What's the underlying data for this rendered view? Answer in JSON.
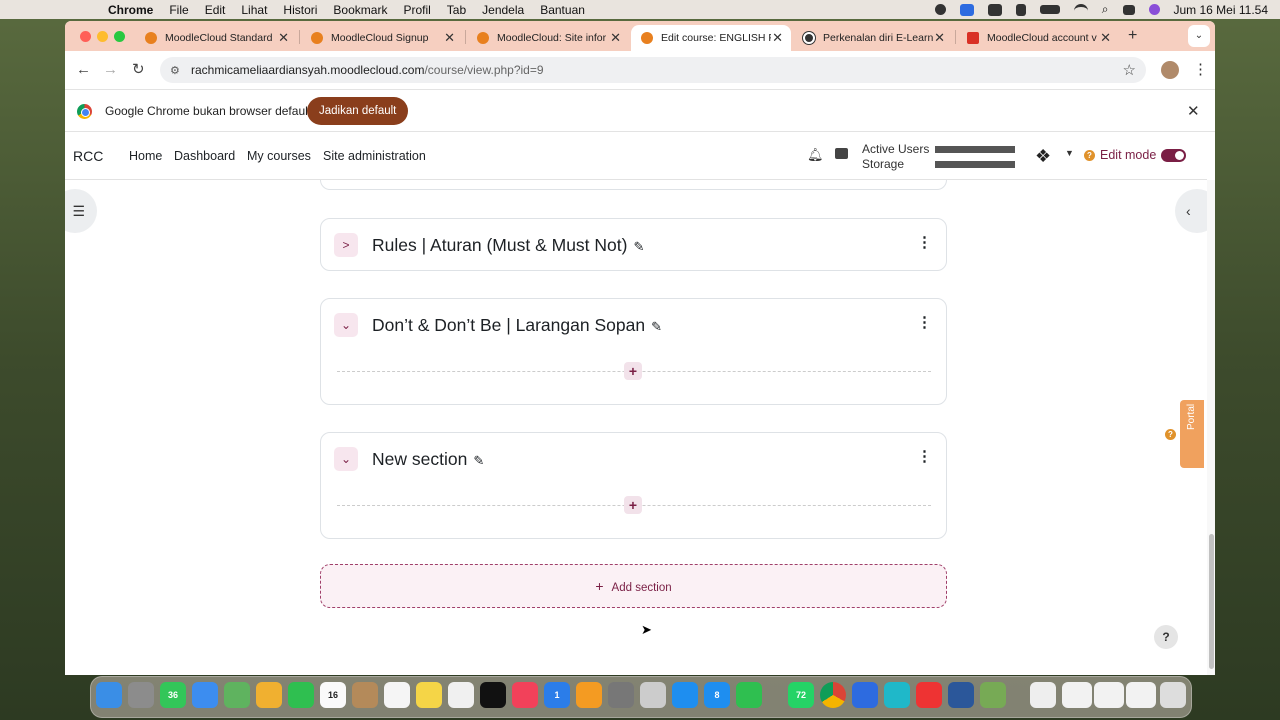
{
  "menubar": {
    "app": "Chrome",
    "items": [
      "File",
      "Edit",
      "Lihat",
      "Histori",
      "Bookmark",
      "Profil",
      "Tab",
      "Jendela",
      "Bantuan"
    ],
    "datetime": "Jum 16 Mei  11.54"
  },
  "tabs": [
    {
      "title": "MoodleCloud Standard",
      "color": "#e8801f"
    },
    {
      "title": "MoodleCloud Signup",
      "color": "#e8801f"
    },
    {
      "title": "MoodleCloud: Site infor",
      "color": "#e8801f"
    },
    {
      "title": "Edit course: ENGLISH F",
      "color": "#e8801f"
    },
    {
      "title": "Perkenalan diri E-Learn",
      "color": "#333333"
    },
    {
      "title": "MoodleCloud account v",
      "color": "#d93025"
    }
  ],
  "toolbar": {
    "url_host": "rachmicameliaardiansyah.moodlecloud.com",
    "url_path": "/course/view.php?id=9"
  },
  "infobar": {
    "message": "Google Chrome bukan browser default",
    "button": "Jadikan default"
  },
  "moodle": {
    "brand": "RCC",
    "nav": [
      "Home",
      "Dashboard",
      "My courses",
      "Site administration"
    ],
    "usage_active": "Active Users",
    "usage_storage": "Storage",
    "edit_mode": "Edit mode",
    "help_badge": "?",
    "sections": [
      {
        "title": "Rules | Aturan (Must & Must Not)",
        "collapsed": true
      },
      {
        "title": "Don’t & Don’t Be | Larangan Sopan",
        "collapsed": false
      },
      {
        "title": "New section",
        "collapsed": false
      }
    ],
    "add_section": "Add section",
    "portal_label": "Portal",
    "help_button": "?"
  },
  "dock": {
    "badges": {
      "messages": "36",
      "calendar_day": "16",
      "keynote": "1",
      "appstore": "8",
      "whatsapp": "72"
    }
  }
}
